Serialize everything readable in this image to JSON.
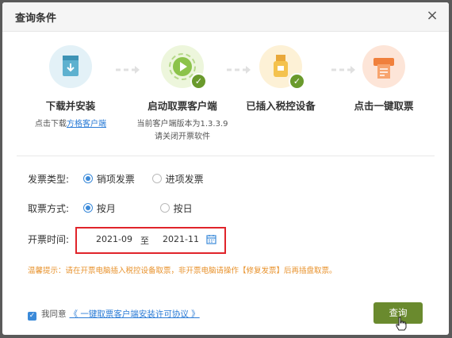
{
  "dialog": {
    "title": "查询条件",
    "close": "×"
  },
  "steps": [
    {
      "title": "下载并安装",
      "sub_prefix": "点击下载",
      "sub_link": "方格客户端",
      "icon": "download-box-icon"
    },
    {
      "title": "启动取票客户端",
      "sub_line1": "当前客户端版本为1.3.3.9",
      "sub_line2": "请关闭开票软件",
      "icon": "play-client-icon",
      "checked": true
    },
    {
      "title": "已插入税控设备",
      "icon": "usb-key-icon",
      "checked": true
    },
    {
      "title": "点击一键取票",
      "icon": "printer-ticket-icon"
    }
  ],
  "form": {
    "invoice_type": {
      "label": "发票类型:",
      "options": [
        "销项发票",
        "进项发票"
      ],
      "selected": "销项发票"
    },
    "fetch_mode": {
      "label": "取票方式:",
      "options": [
        "按月",
        "按日"
      ],
      "selected": "按月"
    },
    "date": {
      "label": "开票时间:",
      "start": "2021-09",
      "sep": "至",
      "end": "2021-11"
    }
  },
  "tip": "温馨提示：请在开票电脑插入税控设备取票，非开票电脑请操作【修复发票】后再插盘取票。",
  "agreement": {
    "prefix": "我同意",
    "link": "《 一键取票客户端安装许可协议 》",
    "checked": true
  },
  "buttons": {
    "query": "查询"
  },
  "colors": {
    "accent_green": "#6a8a2e",
    "blue": "#3b8ad9",
    "tip_orange": "#e8922c",
    "highlight_red": "#e0242a"
  }
}
